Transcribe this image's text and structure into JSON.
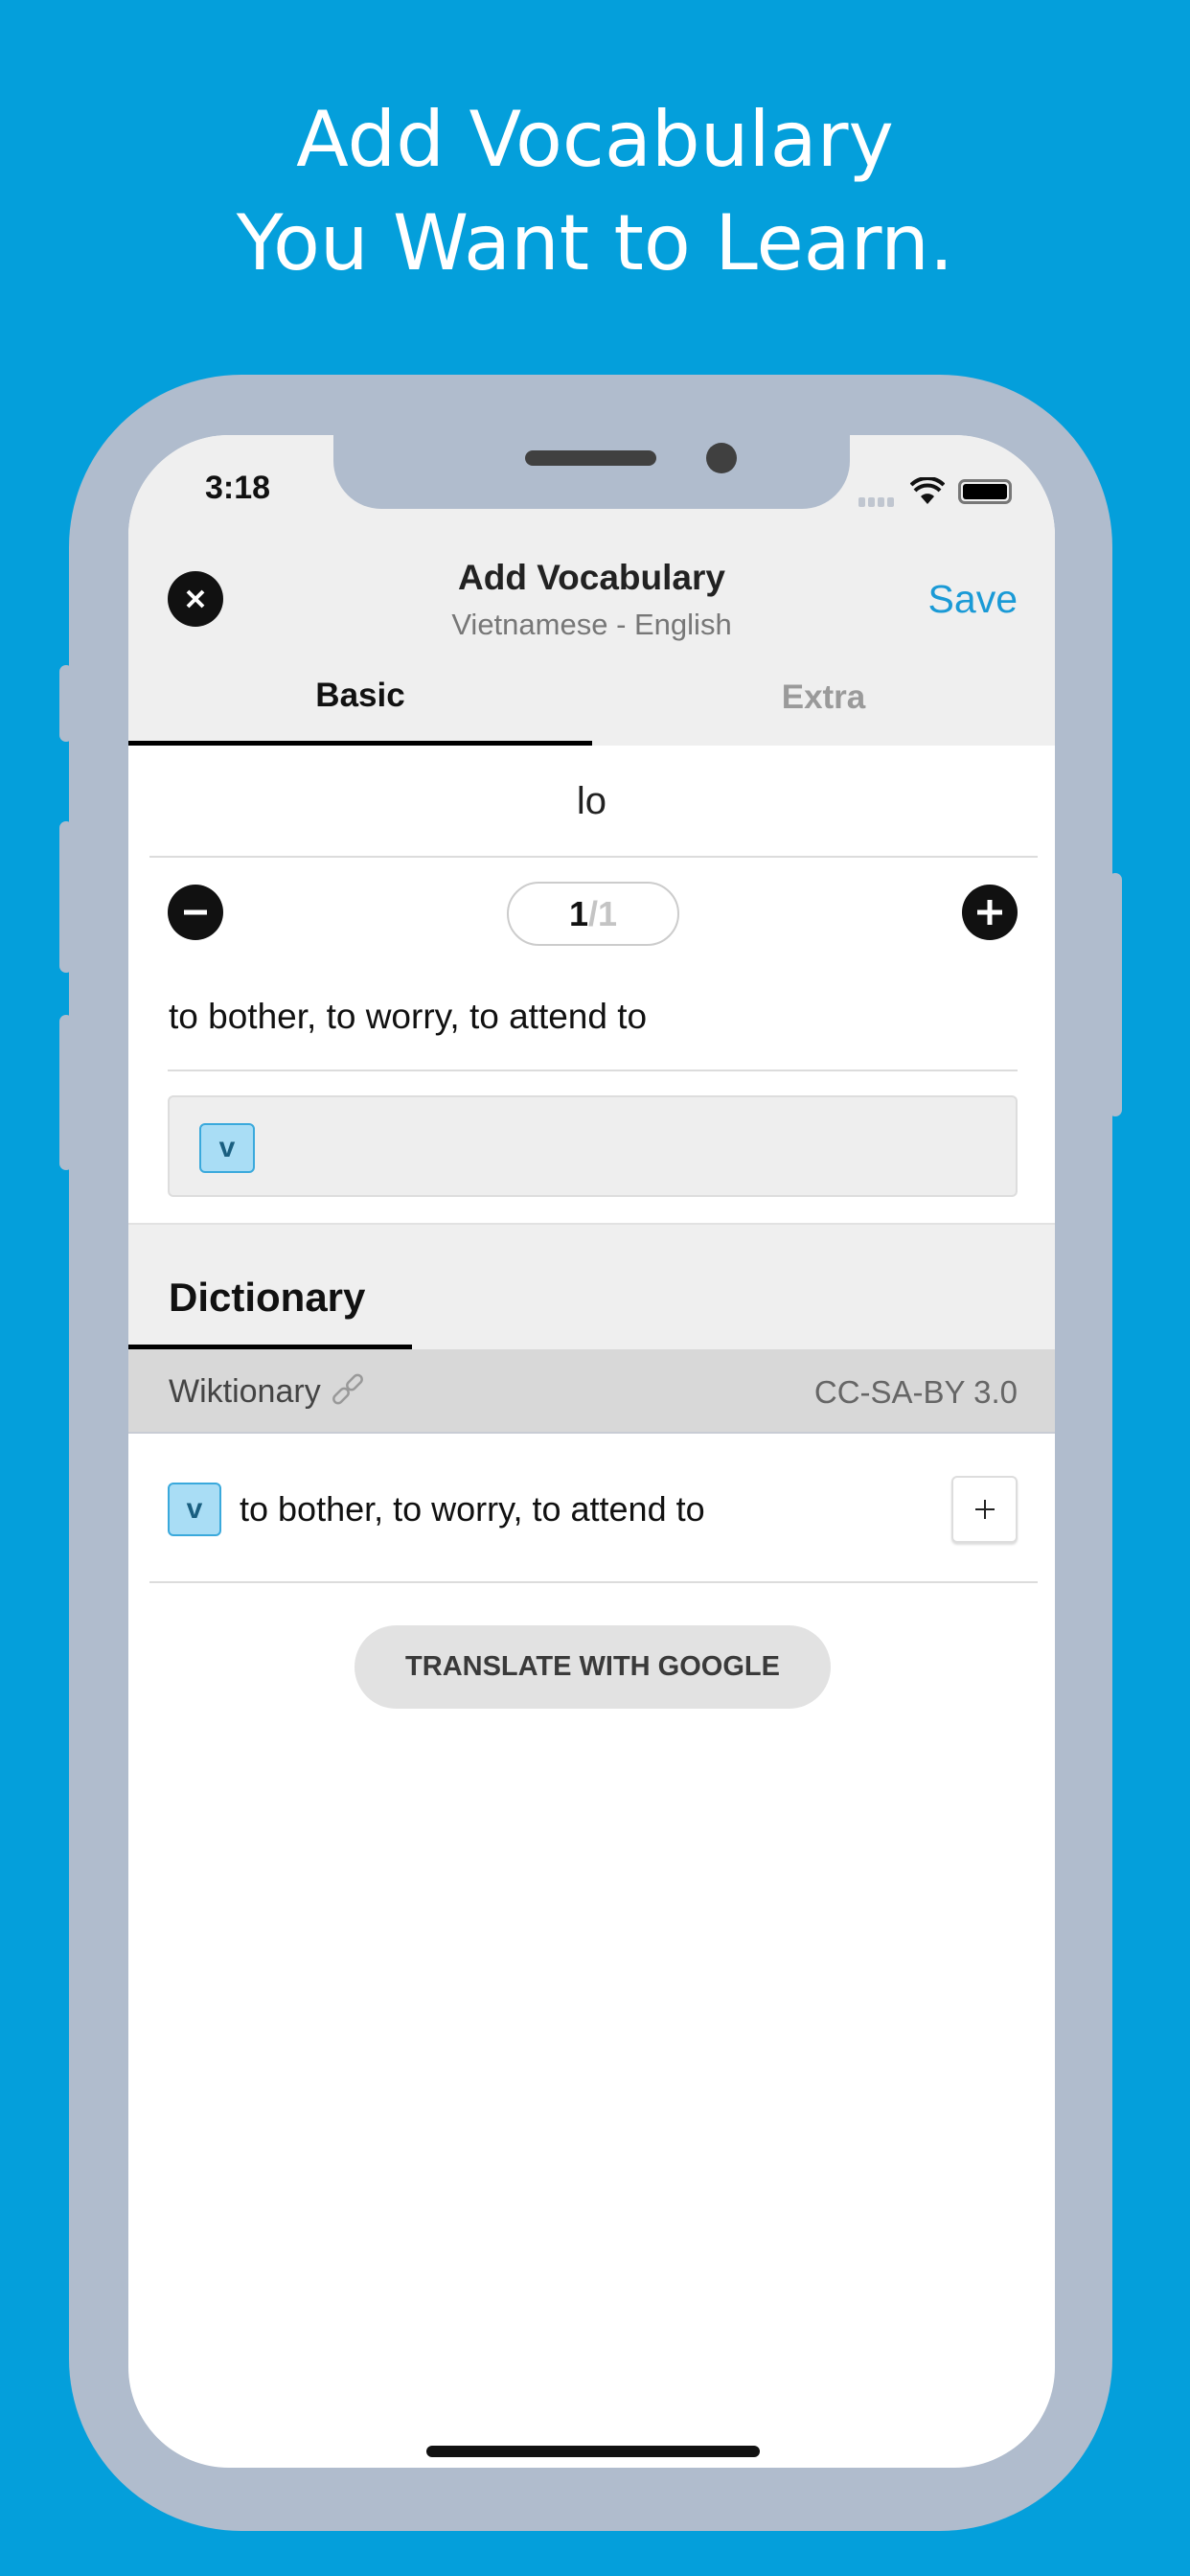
{
  "promo": {
    "line1": "Add Vocabulary",
    "line2": "You Want to Learn."
  },
  "status_bar": {
    "time": "3:18"
  },
  "nav": {
    "title": "Add Vocabulary",
    "subtitle": "Vietnamese - English",
    "save_label": "Save"
  },
  "tabs": [
    {
      "label": "Basic",
      "active": true
    },
    {
      "label": "Extra",
      "active": false
    }
  ],
  "entry": {
    "word": "lo",
    "page_current": "1",
    "page_total": "/1",
    "definition": "to bother, to worry, to attend to",
    "tags": [
      "v"
    ]
  },
  "dictionary": {
    "heading": "Dictionary",
    "source": "Wiktionary",
    "license": "CC-SA-BY 3.0",
    "results": [
      {
        "pos": "v",
        "definition": "to bother, to worry, to attend to"
      }
    ],
    "translate_label": "TRANSLATE WITH GOOGLE"
  },
  "colors": {
    "background": "#049fdb",
    "accent": "#1a9ad6",
    "phone_frame": "#b0bccd"
  }
}
